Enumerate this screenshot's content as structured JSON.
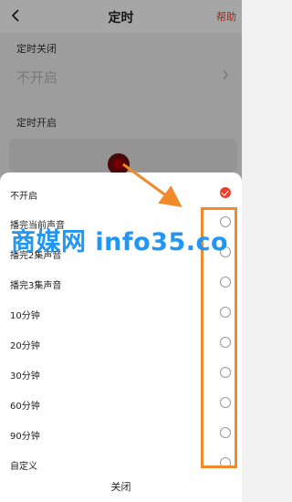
{
  "header": {
    "title": "定时",
    "help_label": "帮助"
  },
  "timer_off": {
    "section_label": "定时关闭",
    "value": "不开启"
  },
  "timer_on": {
    "section_label": "定时开启"
  },
  "sheet": {
    "options": [
      {
        "label": "不开启",
        "selected": true
      },
      {
        "label": "播完当前声音",
        "selected": false
      },
      {
        "label": "播完2集声音",
        "selected": false
      },
      {
        "label": "播完3集声音",
        "selected": false
      },
      {
        "label": "10分钟",
        "selected": false
      },
      {
        "label": "20分钟",
        "selected": false
      },
      {
        "label": "30分钟",
        "selected": false
      },
      {
        "label": "60分钟",
        "selected": false
      },
      {
        "label": "90分钟",
        "selected": false
      },
      {
        "label": "自定义",
        "selected": false
      }
    ],
    "close_label": "关闭"
  },
  "watermark": "商媒网 info35.co",
  "colors": {
    "accent": "#e8402f",
    "annotation": "#f08a2a",
    "watermark": "#2196f3"
  }
}
